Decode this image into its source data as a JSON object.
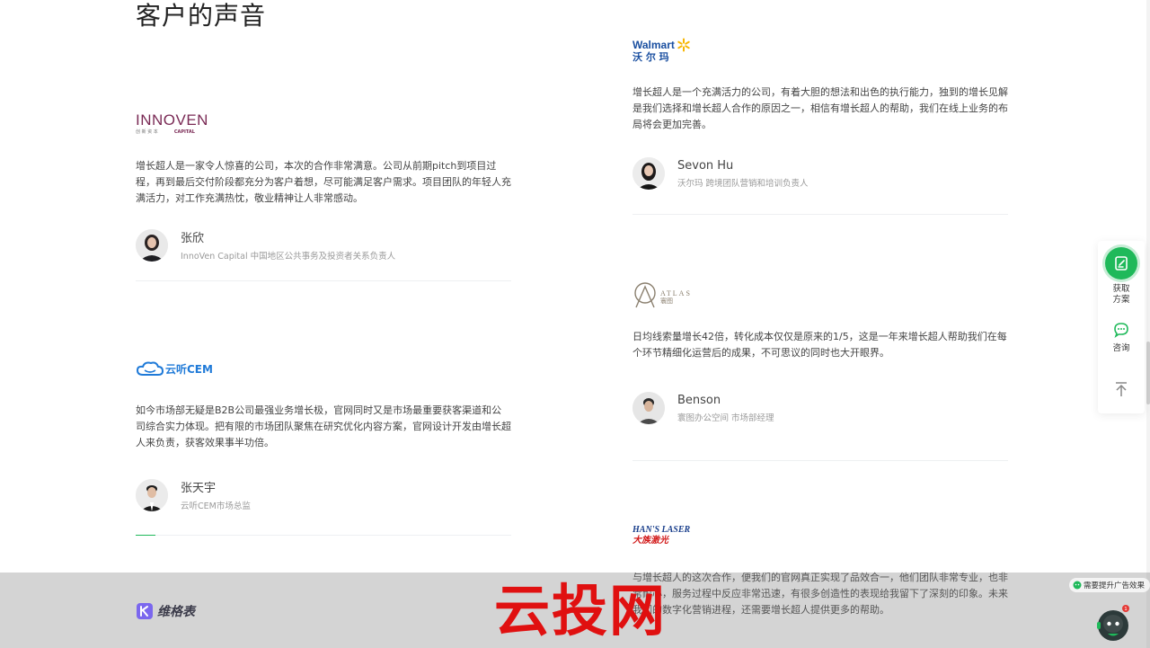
{
  "section": {
    "title": "客户的声音"
  },
  "testimonials": [
    {
      "logo_text": "INNOVEN",
      "logo_sub": "CAPITAL",
      "logo_cn": "创 新 资 本",
      "quote": "增长超人是一家令人惊喜的公司，本次的合作非常满意。公司从前期pitch到项目过程，再到最后交付阶段都充分为客户着想，尽可能满足客户需求。项目团队的年轻人充满活力，对工作充满热忱，敬业精神让人非常感动。",
      "name": "张欣",
      "title": "InnoVen Capital 中国地区公共事务及投资者关系负责人"
    },
    {
      "logo_text": "Walmart",
      "logo_cn": "沃 尔 玛",
      "quote": "增长超人是一个充满活力的公司，有着大胆的想法和出色的执行能力，独到的增长见解是我们选择和增长超人合作的原因之一，相信有增长超人的帮助，我们在线上业务的布局将会更加完善。",
      "name": "Sevon Hu",
      "title": "沃尔玛 跨境团队营销和培训负责人"
    },
    {
      "logo_text": "ATLAS",
      "logo_cn": "寰图",
      "quote": "日均线索量增长42倍，转化成本仅仅是原来的1/5，这是一年来增长超人帮助我们在每个环节精细化运营后的成果，不可思议的同时也大开眼界。",
      "name": "Benson",
      "title": "寰图办公空间 市场部经理"
    },
    {
      "logo_text": "云听CEM",
      "quote": "如今市场部无疑是B2B公司最强业务增长极，官网同时又是市场最重要获客渠道和公司综合实力体现。把有限的市场团队聚焦在研究优化内容方案，官网设计开发由增长超人来负责，获客效果事半功倍。",
      "name": "张天宇",
      "title": "云听CEM市场总监"
    },
    {
      "logo_text": "HAN'S LASER",
      "logo_cn": "大族激光",
      "quote": "与增长超人的这次合作，便我们的官网真正实现了品效合一，他们团队非常专业，也非常耐心，服务过程中反应非常迅速，有很多创造性的表现给我留下了深刻的印象。未来我们的数字化营销进程，还需要增长超人提供更多的帮助。"
    }
  ],
  "floatbar": {
    "get_plan": "获取\n方案",
    "consult": "咨询"
  },
  "footer": {
    "brand": "维格表"
  },
  "watermark": "云投网",
  "ad_pill": "需要提升广告效果",
  "colors": {
    "accent_green": "#1fb95a",
    "divider": "#eef0f2",
    "watermark_red": "#e01010"
  }
}
